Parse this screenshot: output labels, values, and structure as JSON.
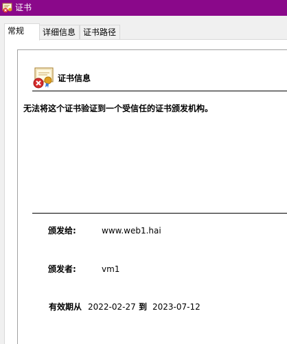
{
  "window": {
    "title": "证书"
  },
  "tabs": [
    {
      "label": "常规"
    },
    {
      "label": "详细信息"
    },
    {
      "label": "证书路径"
    }
  ],
  "cert": {
    "heading": "证书信息",
    "warning": "无法将这个证书验证到一个受信任的证书颁发机构。",
    "issued_to_label": "颁发给:",
    "issued_to_value": "www.web1.hai",
    "issued_by_label": "颁发者:",
    "issued_by_value": "vm1",
    "validity_label": "有效期从",
    "valid_from": "2022-02-27",
    "to_label": "到",
    "valid_to": "2023-07-12"
  },
  "colors": {
    "titlebar": "#8a088a",
    "error_badge": "#d62b2b",
    "seal": "#e0a020"
  },
  "icons": {
    "app": "certificate-icon",
    "cert": "certificate-error-icon"
  }
}
